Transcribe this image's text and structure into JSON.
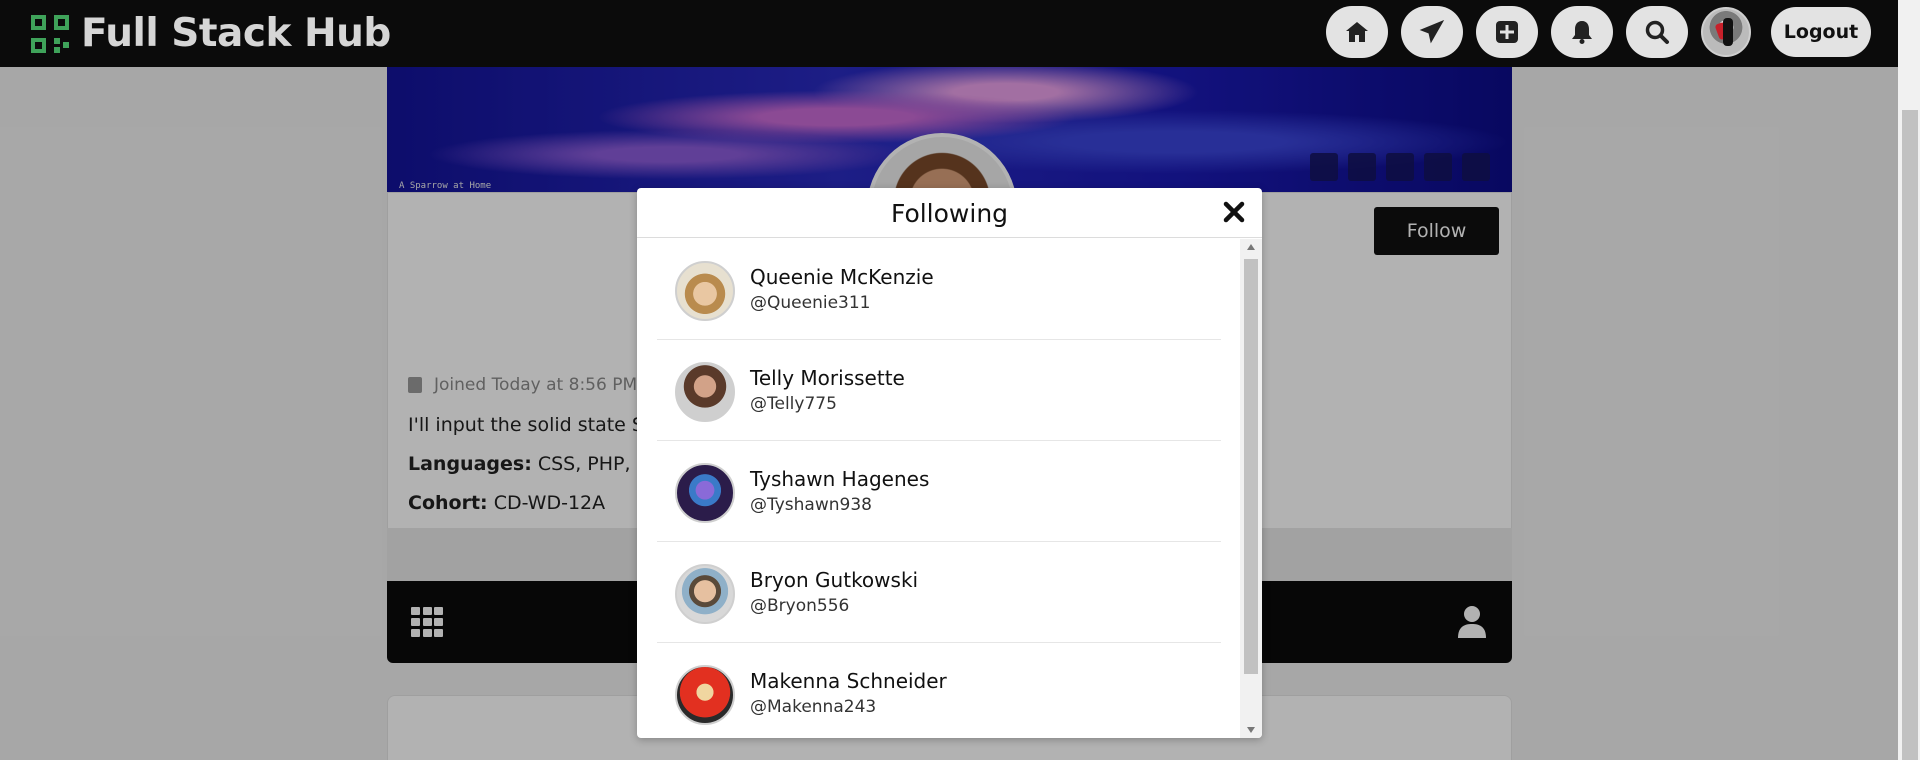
{
  "navbar": {
    "brand": "Full Stack Hub",
    "logout_label": "Logout",
    "icons": [
      "home-icon",
      "send-icon",
      "plus-square-icon",
      "bell-icon",
      "search-icon"
    ]
  },
  "profile": {
    "cover_caption": "A Sparrow at Home",
    "follow_label": "Follow",
    "joined": "Joined Today at 8:56 PM",
    "bio": "I'll input the solid state SQ",
    "languages_label": "Languages:",
    "languages_value": "CSS, PHP, SQL",
    "cohort_label": "Cohort:",
    "cohort_value": "CD-WD-12A"
  },
  "modal": {
    "title": "Following",
    "items": [
      {
        "name": "Queenie McKenzie",
        "handle": "@Queenie311"
      },
      {
        "name": "Telly Morissette",
        "handle": "@Telly775"
      },
      {
        "name": "Tyshawn Hagenes",
        "handle": "@Tyshawn938"
      },
      {
        "name": "Bryon Gutkowski",
        "handle": "@Bryon556"
      },
      {
        "name": "Makenna Schneider",
        "handle": "@Makenna243"
      }
    ]
  },
  "colors": {
    "nav_bg": "#0b0b0b",
    "brand_accent": "#3fa35a",
    "button_dark": "#111111",
    "nav_button_bg": "#e3e3e3"
  }
}
